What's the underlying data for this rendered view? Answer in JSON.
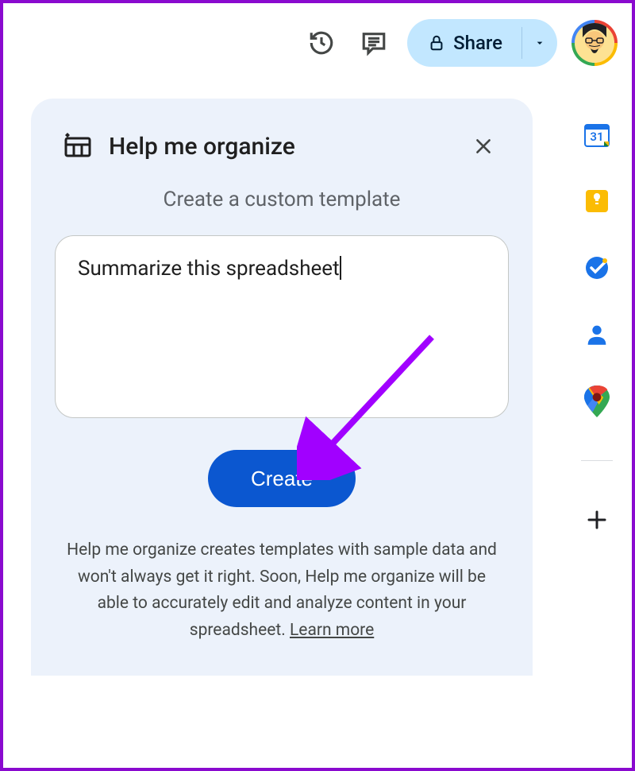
{
  "toolbar": {
    "share_label": "Share"
  },
  "panel": {
    "title": "Help me organize",
    "subtitle": "Create a custom template",
    "input_value": "Summarize this spreadsheet",
    "create_label": "Create",
    "disclaimer_text": "Help me organize creates templates with sample data and won't always get it right. Soon, Help me organize will be able to accurately edit and analyze content in your spreadsheet. ",
    "learn_more_label": "Learn more"
  },
  "side_rail": {
    "calendar_date": "31"
  }
}
